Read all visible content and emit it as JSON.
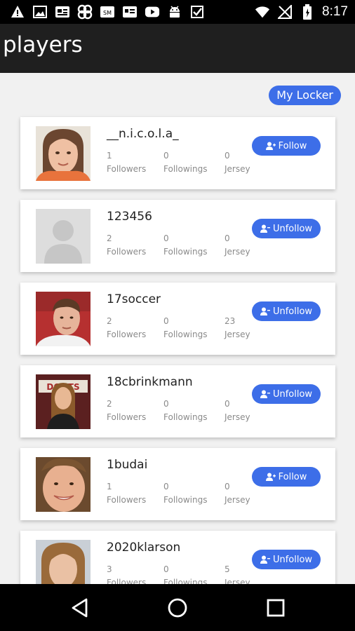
{
  "status_bar": {
    "time": "8:17",
    "left_icons": [
      "warning-icon",
      "image-icon",
      "news-icon",
      "clover-icon",
      "badge-icon",
      "card-icon",
      "youtube-icon",
      "android-icon",
      "checkmark-icon"
    ],
    "right_icons": [
      "wifi-icon",
      "no-sim-icon",
      "battery-icon"
    ]
  },
  "app_bar": {
    "title": "players"
  },
  "locker": {
    "label": "My Locker"
  },
  "stat_labels": {
    "followers": "Followers",
    "followings": "Followings",
    "jersey": "Jersey"
  },
  "players": [
    {
      "username": "__n.i.c.o.l.a_",
      "followers": "1",
      "followings": "0",
      "jersey": "0",
      "action": "Follow",
      "avatar": "photo-woman-1"
    },
    {
      "username": "123456",
      "followers": "2",
      "followings": "0",
      "jersey": "0",
      "action": "Unfollow",
      "avatar": "placeholder"
    },
    {
      "username": "17soccer",
      "followers": "2",
      "followings": "0",
      "jersey": "23",
      "action": "Unfollow",
      "avatar": "photo-man"
    },
    {
      "username": "18cbrinkmann",
      "followers": "2",
      "followings": "0",
      "jersey": "0",
      "action": "Unfollow",
      "avatar": "photo-woman-2"
    },
    {
      "username": "1budai",
      "followers": "1",
      "followings": "0",
      "jersey": "0",
      "action": "Follow",
      "avatar": "photo-woman-3"
    },
    {
      "username": "2020klarson",
      "followers": "3",
      "followings": "0",
      "jersey": "5",
      "action": "Unfollow",
      "avatar": "photo-woman-4"
    }
  ],
  "colors": {
    "accent": "#3d6ee8",
    "app_bar": "#1f1f1f",
    "background": "#f1f1f1"
  },
  "nav_bar": {
    "buttons": [
      "back-icon",
      "home-icon",
      "recents-icon"
    ]
  }
}
